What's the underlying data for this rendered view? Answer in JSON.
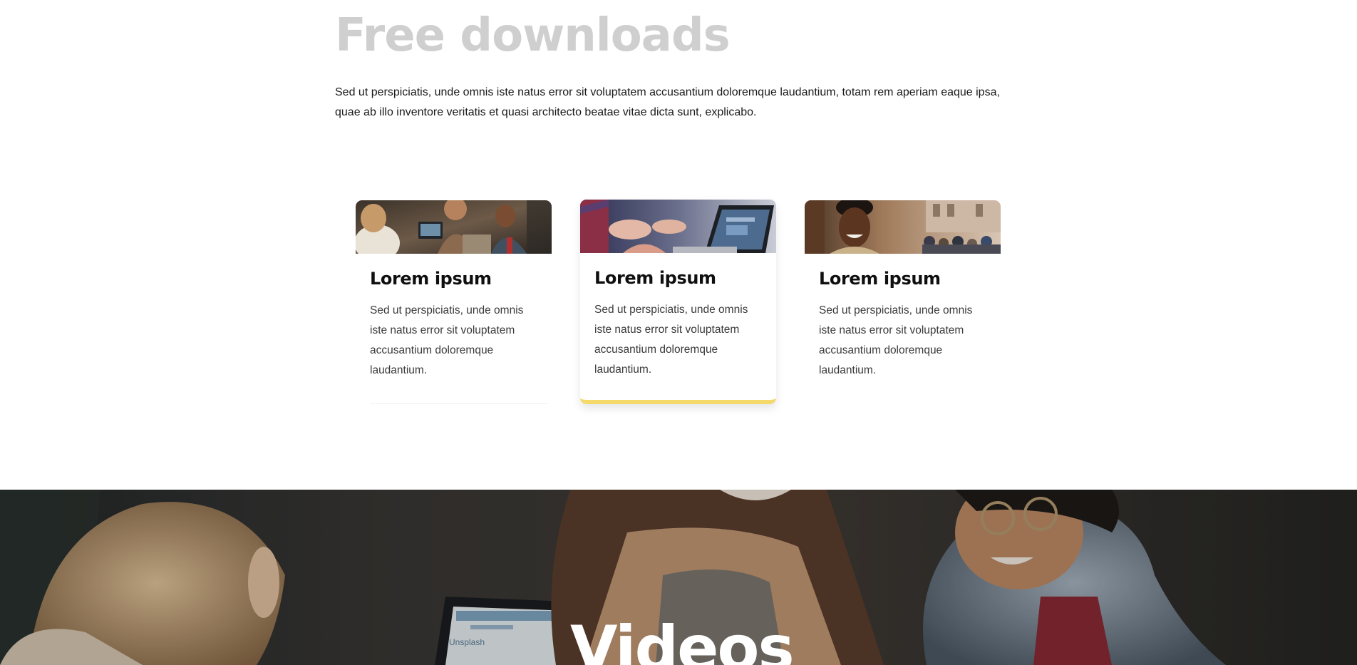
{
  "free_downloads": {
    "title": "Free downloads",
    "description": "Sed ut perspiciatis, unde omnis iste natus error sit voluptatem accusantium doloremque laudantium, totam rem aperiam eaque ipsa, quae ab illo inventore veritatis et quasi architecto beatae vitae dicta sunt, explicabo."
  },
  "cards": [
    {
      "title": "Lorem ipsum",
      "text": "Sed ut perspiciatis, unde omnis iste natus error sit voluptatem accusantium doloremque laudantium.",
      "image": "friends-with-laptop-photo"
    },
    {
      "title": "Lorem ipsum",
      "text": "Sed ut perspiciatis, unde omnis iste natus error sit voluptatem accusantium doloremque laudantium.",
      "image": "hands-gesturing-at-laptop-photo"
    },
    {
      "title": "Lorem ipsum",
      "text": "Sed ut perspiciatis, unde omnis iste natus error sit voluptatem accusantium doloremque laudantium.",
      "image": "smiling-man-on-street-photo"
    }
  ],
  "videos": {
    "title": "Videos",
    "background": "laughing-friends-photo",
    "laptop_screen_text": "Unsplash"
  },
  "colors": {
    "title_gray": "#cfcfcf",
    "card_accent": "#f5d96b",
    "text": "#1a1a1a"
  }
}
